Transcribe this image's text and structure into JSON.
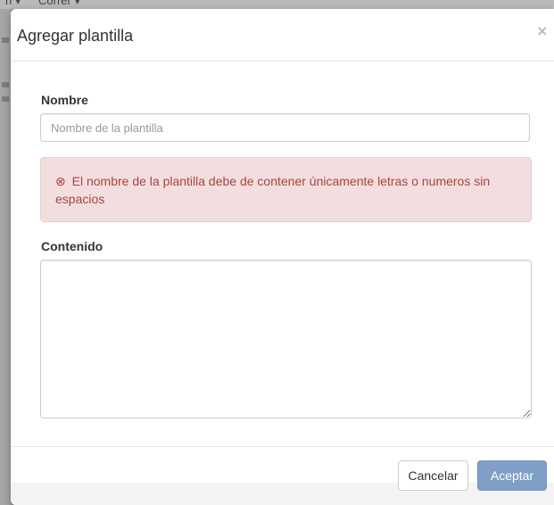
{
  "background": {
    "menu_items": [
      "n ▾",
      "Correr ▾"
    ]
  },
  "modal": {
    "title": "Agregar plantilla",
    "close_symbol": "×",
    "name_label": "Nombre",
    "name_placeholder": "Nombre de la plantilla",
    "name_value": "",
    "error": {
      "icon": "⊗",
      "icon_name": "error-circle-icon",
      "message": "El nombre de la plantilla debe de contener únicamente letras o numeros sin espacios",
      "color": "#a94442",
      "background": "#f2dede"
    },
    "content_label": "Contenido",
    "content_value": "",
    "cancel_label": "Cancelar",
    "accept_label": "Aceptar",
    "accept_color": "#7f9fc6"
  }
}
